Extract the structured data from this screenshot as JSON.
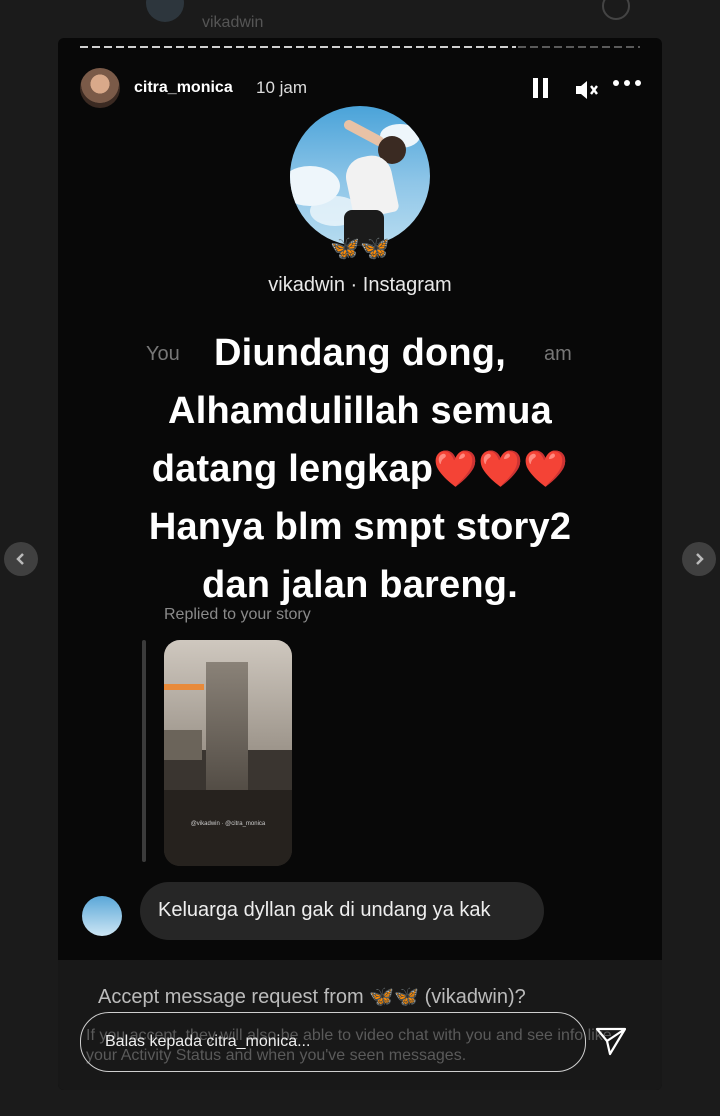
{
  "previous_story": {
    "username": "vikadwin"
  },
  "story": {
    "header": {
      "username": "citra_monica",
      "time": "10 jam"
    },
    "dm": {
      "butterfly_icons": "🦋🦋",
      "account_line": "vikadwin · Instagram",
      "hidden_left": "You",
      "hidden_right": "am",
      "overlay_lines": [
        "Diundang dong,",
        "Alhamdulillah semua",
        "datang lengkap",
        "Hanya blm smpt story2",
        "dan jalan bareng."
      ],
      "hearts": "❤️❤️❤️",
      "replied_label": "Replied to your story",
      "thumbnail_text": "@vikadwin · @citra_monica",
      "message_text": "Keluarga dyllan gak di undang ya kak"
    },
    "footer": {
      "request_prefix": "Accept message request from",
      "request_icons": "🦋🦋",
      "request_suffix": "(vikadwin)?",
      "info_text": "If you accept, they will also be able to video chat with you and see info like your Activity Status and when you've seen messages.",
      "reply_placeholder": "Balas kepada citra_monica..."
    }
  }
}
